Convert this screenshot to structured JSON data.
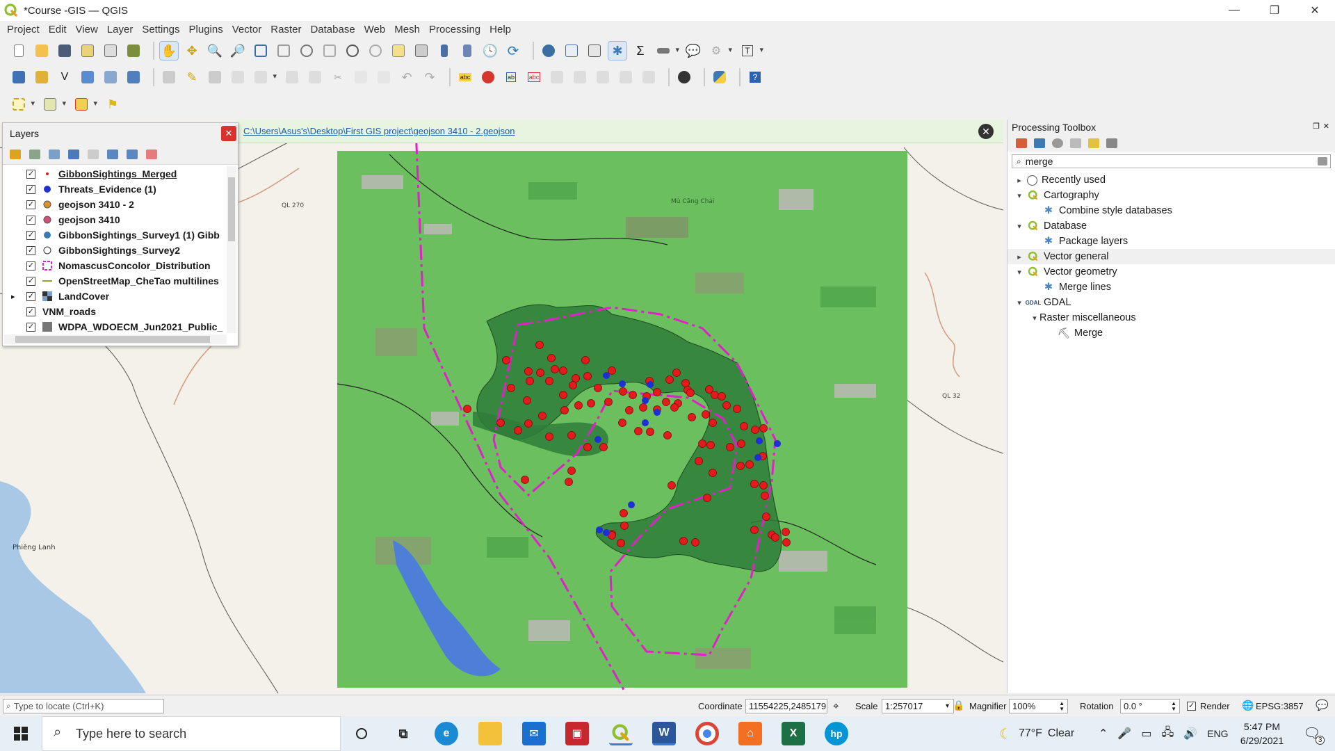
{
  "window": {
    "title": "*Course -GIS — QGIS"
  },
  "menu": [
    "Project",
    "Edit",
    "View",
    "Layer",
    "Settings",
    "Plugins",
    "Vector",
    "Raster",
    "Database",
    "Web",
    "Mesh",
    "Processing",
    "Help"
  ],
  "infobar": {
    "path": "C:\\Users\\Asus's\\Desktop\\First GIS project\\geojson 3410 - 2.geojson"
  },
  "layers_panel": {
    "title": "Layers",
    "items": [
      {
        "name": "GibbonSightings_Merged",
        "checked": "✓",
        "symbol": "dot-red-small",
        "selected": true
      },
      {
        "name": "Threats_Evidence (1)",
        "checked": "✓",
        "symbol": "dot-blue"
      },
      {
        "name": "geojson 3410 - 2",
        "checked": "✓",
        "symbol": "dot-orange"
      },
      {
        "name": "geojson 3410",
        "checked": "✓",
        "symbol": "dot-pink"
      },
      {
        "name": "GibbonSightings_Survey1 (1) Gibb",
        "checked": "✓",
        "symbol": "dot-steelblue"
      },
      {
        "name": "GibbonSightings_Survey2",
        "checked": "✓",
        "symbol": "dot-hollow"
      },
      {
        "name": "NomascusConcolor_Distribution",
        "checked": "✓",
        "symbol": "polygon-magenta-dashed"
      },
      {
        "name": "OpenStreetMap_CheTao multilines",
        "checked": "✓",
        "symbol": "line-olive"
      },
      {
        "name": "LandCover",
        "checked": "✓",
        "symbol": "raster"
      },
      {
        "name": "VNM_roads",
        "checked": "✓",
        "symbol": "none"
      },
      {
        "name": "WDPA_WDOECM_Jun2021_Public_",
        "checked": "✓",
        "symbol": "polygon-grey"
      }
    ]
  },
  "processing": {
    "title": "Processing Toolbox",
    "search_value": "merge",
    "tree": [
      {
        "label": "Recently used",
        "arrow": "▸",
        "icon": "clock-icon",
        "level": 0
      },
      {
        "label": "Cartography",
        "arrow": "▾",
        "icon": "qgis-icon",
        "level": 0
      },
      {
        "label": "Combine style databases",
        "arrow": "",
        "icon": "gear-icon",
        "level": 1
      },
      {
        "label": "Database",
        "arrow": "▾",
        "icon": "qgis-icon",
        "level": 0
      },
      {
        "label": "Package layers",
        "arrow": "",
        "icon": "gear-icon",
        "level": 1
      },
      {
        "label": "Vector general",
        "arrow": "▸",
        "icon": "qgis-icon",
        "level": 0,
        "highlight": true
      },
      {
        "label": "Vector geometry",
        "arrow": "▾",
        "icon": "qgis-icon",
        "level": 0
      },
      {
        "label": "Merge lines",
        "arrow": "",
        "icon": "gear-icon",
        "level": 1
      },
      {
        "label": "GDAL",
        "arrow": "▾",
        "icon": "gdal-icon",
        "level": 0
      },
      {
        "label": "Raster miscellaneous",
        "arrow": "▾",
        "icon": "none",
        "level": 1
      },
      {
        "label": "Merge",
        "arrow": "",
        "icon": "merge-tool-icon",
        "level": 2
      }
    ]
  },
  "map_labels": [
    "QL 270",
    "Phiêng Lanh",
    "QL 32",
    "Mù Căng Chải"
  ],
  "status": {
    "locate_placeholder": "Type to locate (Ctrl+K)",
    "coordinate_label": "Coordinate",
    "coordinate_value": "11554225,2485179",
    "scale_label": "Scale",
    "scale_value": "1:257017",
    "magnifier_label": "Magnifier",
    "magnifier_value": "100%",
    "rotation_label": "Rotation",
    "rotation_value": "0.0 °",
    "render_label": "Render",
    "render_checked": "✓",
    "crs": "EPSG:3857"
  },
  "taskbar": {
    "search_placeholder": "Type here to search",
    "weather_temp": "77°F",
    "weather_text": "Clear",
    "language": "ENG",
    "time": "5:47 PM",
    "date": "6/29/2021",
    "notification_count": "3"
  },
  "colors": {
    "sighting_red": "#e41a1c",
    "threat_blue": "#1f2fd6",
    "distribution_magenta": "#e020c8",
    "protected_area": "#2f7d3a",
    "landcover_green": "#6cbf5e"
  }
}
